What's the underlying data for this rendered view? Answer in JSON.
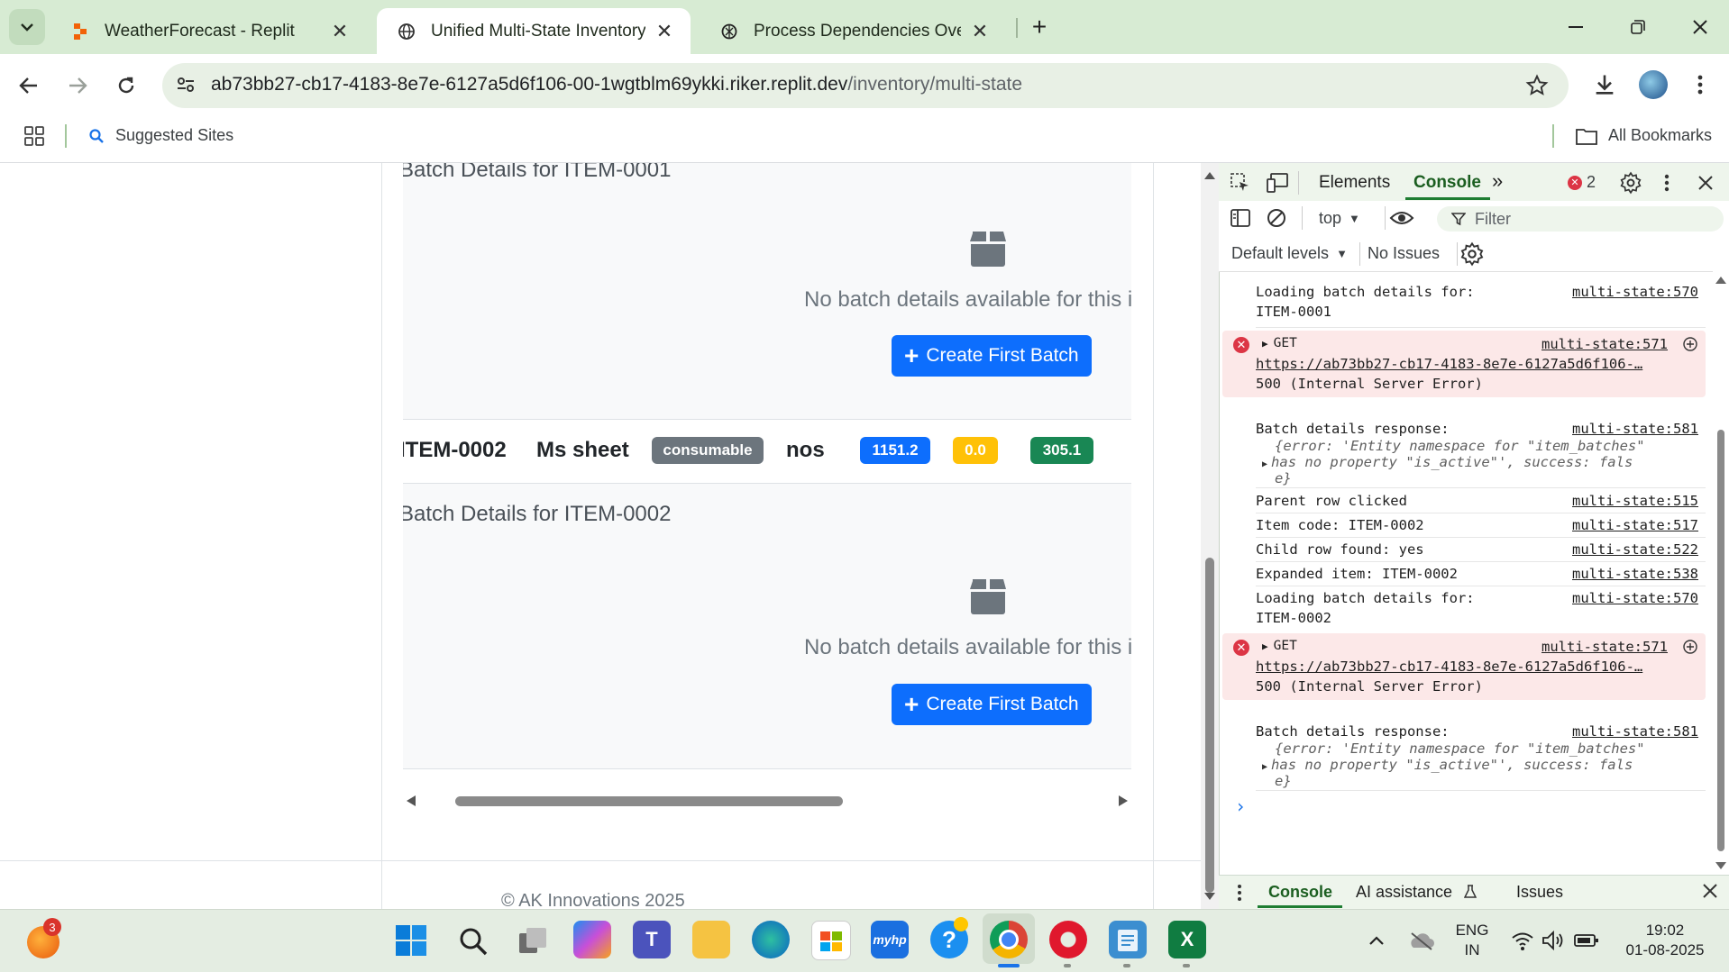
{
  "browser": {
    "tabs": [
      {
        "title": "WeatherForecast - Replit",
        "favicon": "replit-icon",
        "active": false
      },
      {
        "title": "Unified Multi-State Inventory - A",
        "favicon": "globe-icon",
        "active": true
      },
      {
        "title": "Process Dependencies Overview",
        "favicon": "openai-icon",
        "active": false
      }
    ],
    "url_host": "ab73bb27-cb17-4183-8e7e-6127a5d6f106-00-1wgtblm69ykki.riker.replit.dev",
    "url_path": "/inventory/multi-state",
    "bookmarks": {
      "suggested": "Suggested Sites",
      "all": "All Bookmarks"
    }
  },
  "page": {
    "batch1": {
      "title": "Batch Details for ITEM-0001",
      "empty_text": "No batch details available for this item",
      "button": "Create First Batch"
    },
    "item_row": {
      "code": "ITEM-0002",
      "name": "Ms sheet",
      "type_badge": "consumable",
      "unit": "nos",
      "badge_blue": "1151.2",
      "badge_yellow": "0.0",
      "badge_green": "305.1"
    },
    "batch2": {
      "title": "Batch Details for ITEM-0002",
      "empty_text": "No batch details available for this item",
      "button": "Create First Batch"
    },
    "footer": "© AK Innovations 2025",
    "colors": {
      "primary": "#0d6efd",
      "secondary": "#6c757d",
      "warning": "#ffc107",
      "success": "#198754"
    }
  },
  "devtools": {
    "tabs": {
      "elements": "Elements",
      "console": "Console"
    },
    "error_count": "2",
    "context": "top",
    "filter_placeholder": "Filter",
    "levels": "Default levels",
    "issues": "No Issues",
    "logs": {
      "l1_a": "Loading batch details for:",
      "l1_b": "ITEM-0001",
      "l1_src": "multi-state:570",
      "e1_method": "GET",
      "e1_url": "https://ab73bb27-cb17-4183-8e7e-6127a5d6f106-…",
      "e1_status": "500 (Internal Server Error)",
      "e1_src": "multi-state:571",
      "r1_a": "Batch details response:",
      "r1_src": "multi-state:581",
      "r1_obj1": "{error: 'Entity namespace for \"item_batches\"",
      "r1_obj2": "has no property \"is_active\"', success: fals",
      "r1_obj3": "e}",
      "p1": "Parent row clicked",
      "p1_src": "multi-state:515",
      "p2": "Item code: ITEM-0002",
      "p2_src": "multi-state:517",
      "p3": "Child row found: yes",
      "p3_src": "multi-state:522",
      "p4": "Expanded item: ITEM-0002",
      "p4_src": "multi-state:538",
      "l2_a": "Loading batch details for:",
      "l2_b": "ITEM-0002",
      "l2_src": "multi-state:570",
      "e2_method": "GET",
      "e2_url": "https://ab73bb27-cb17-4183-8e7e-6127a5d6f106-…",
      "e2_status": "500 (Internal Server Error)",
      "e2_src": "multi-state:571",
      "r2_a": "Batch details response:",
      "r2_src": "multi-state:581",
      "r2_obj1": "{error: 'Entity namespace for \"item_batches\"",
      "r2_obj2": "has no property \"is_active\"', success: fals",
      "r2_obj3": "e}"
    },
    "drawer": {
      "console": "Console",
      "ai": "AI assistance",
      "issues": "Issues"
    }
  },
  "taskbar": {
    "notification_count": "3",
    "lang_1": "ENG",
    "lang_2": "IN",
    "time": "19:02",
    "date": "01-08-2025"
  }
}
